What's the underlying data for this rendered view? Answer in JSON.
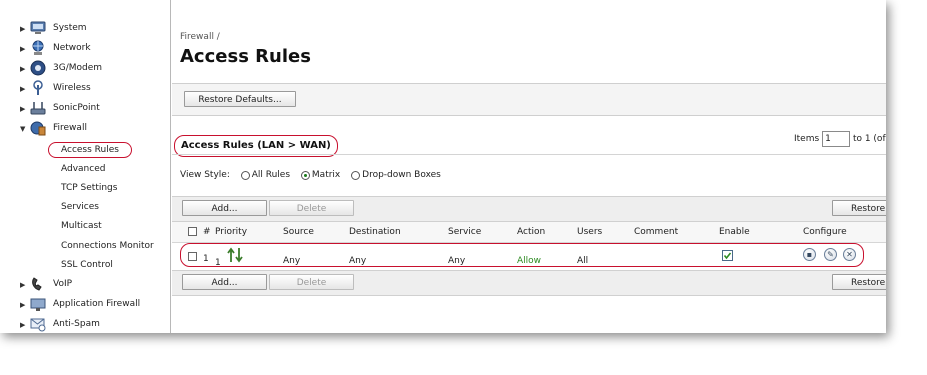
{
  "sidebar": {
    "items": [
      {
        "label": "System",
        "icon": "computer-icon",
        "arrow": "▶"
      },
      {
        "label": "Network",
        "icon": "network-icon",
        "arrow": "▶"
      },
      {
        "label": "3G/Modem",
        "icon": "modem-icon",
        "arrow": "▶"
      },
      {
        "label": "Wireless",
        "icon": "antenna-icon",
        "arrow": "▶"
      },
      {
        "label": "SonicPoint",
        "icon": "access-point-icon",
        "arrow": "▶"
      },
      {
        "label": "Firewall",
        "icon": "firewall-icon",
        "arrow": "▼"
      }
    ],
    "firewall_sub": [
      {
        "label": "Access Rules"
      },
      {
        "label": "Advanced"
      },
      {
        "label": "TCP Settings"
      },
      {
        "label": "Services"
      },
      {
        "label": "Multicast"
      },
      {
        "label": "Connections Monitor"
      },
      {
        "label": "SSL Control"
      }
    ],
    "bottom_items": [
      {
        "label": "VoIP",
        "icon": "voip-phone-icon",
        "arrow": "▶"
      },
      {
        "label": "Application Firewall",
        "icon": "app-firewall-icon",
        "arrow": "▶"
      },
      {
        "label": "Anti-Spam",
        "icon": "anti-spam-icon",
        "arrow": "▶"
      }
    ]
  },
  "header": {
    "breadcrumb": "Firewall /",
    "title": "Access Rules"
  },
  "toolbar": {
    "restore_defaults": "Restore Defaults..."
  },
  "section": {
    "title": "Access Rules (LAN > WAN)",
    "items_label": "Items",
    "items_value": "1",
    "items_suffix": "to 1 (of"
  },
  "view_style": {
    "label": "View Style:",
    "options": [
      "All Rules",
      "Matrix",
      "Drop-down Boxes"
    ],
    "selected": "Matrix"
  },
  "table_actions": {
    "add": "Add...",
    "delete": "Delete",
    "restore": "Restore"
  },
  "columns": [
    "#",
    "Priority",
    "Source",
    "Destination",
    "Service",
    "Action",
    "Users",
    "Comment",
    "Enable",
    "Configure"
  ],
  "rows": [
    {
      "num": "1",
      "priority": "1",
      "source": "Any",
      "destination": "Any",
      "service": "Any",
      "action": "Allow",
      "users": "All",
      "comment": "",
      "enabled": true
    }
  ],
  "colors": {
    "highlight": "#c8102e",
    "allow": "#2e8b22"
  }
}
